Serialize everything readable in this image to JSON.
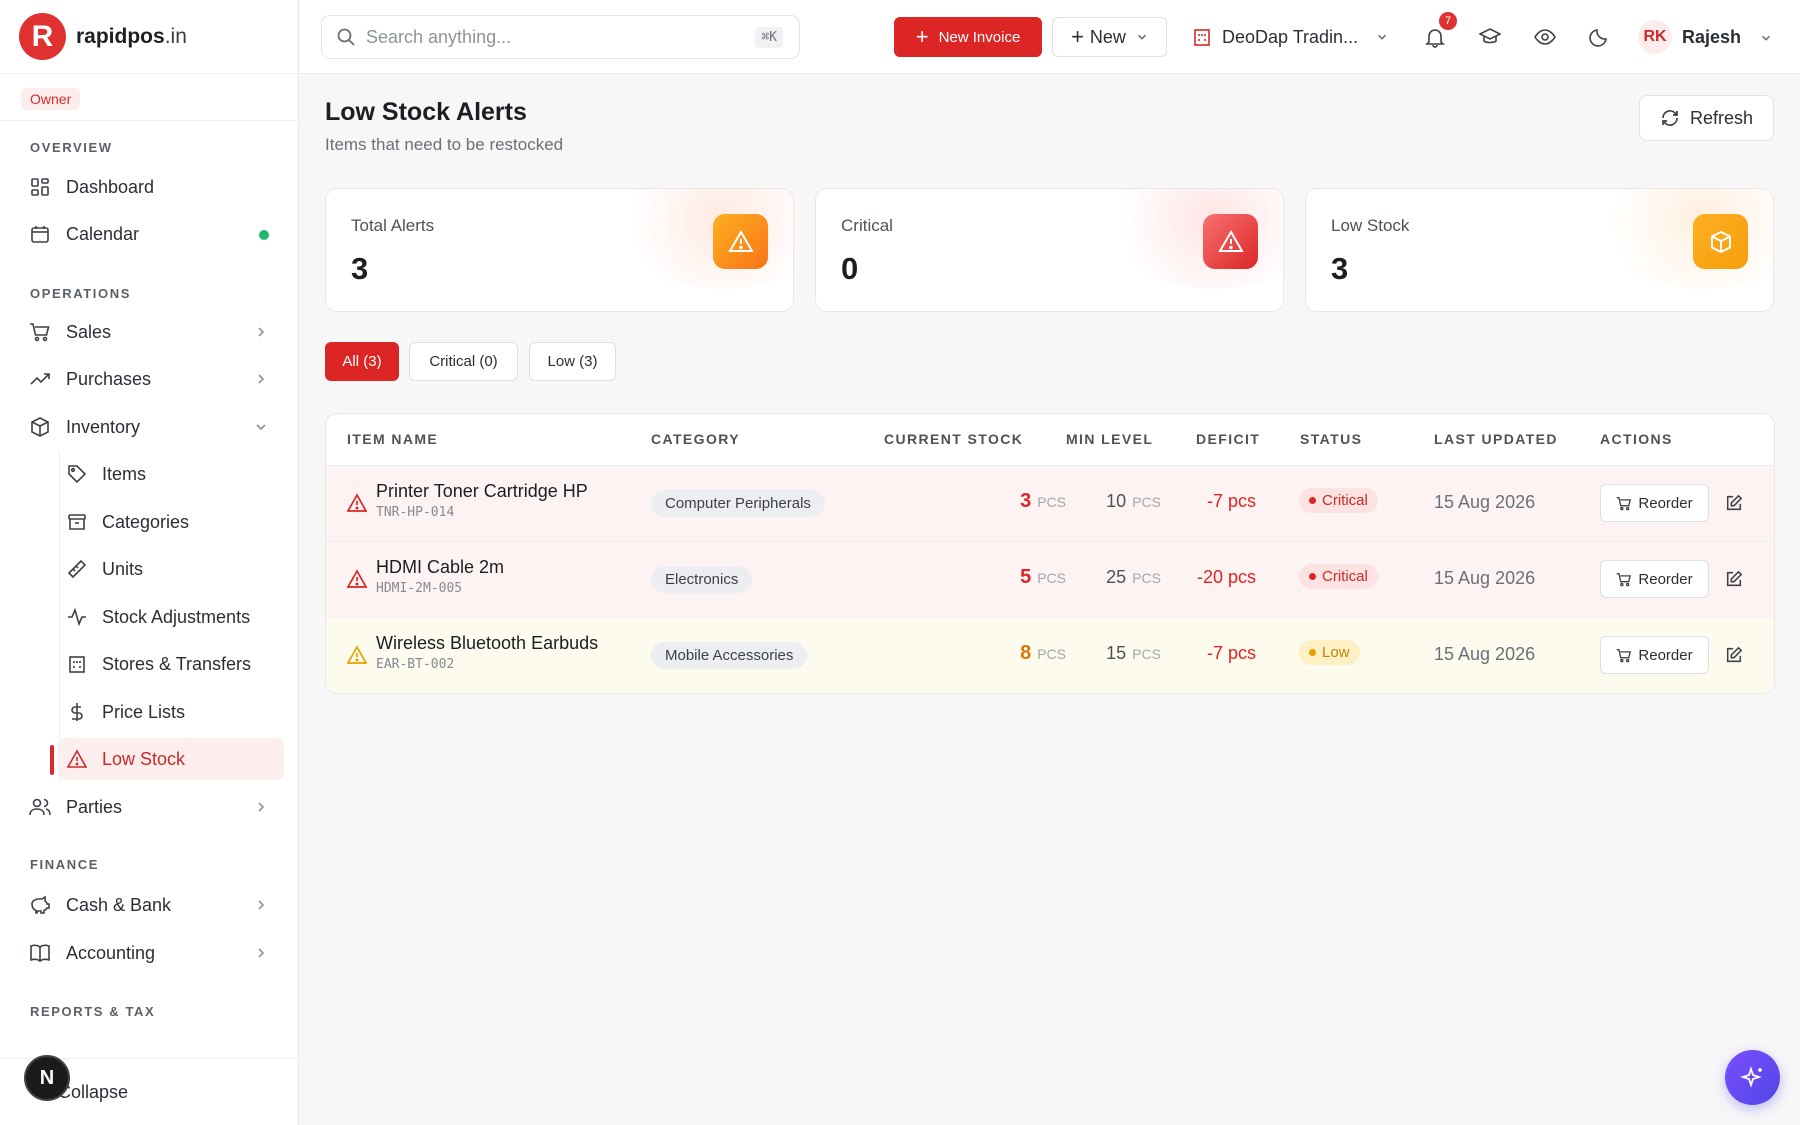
{
  "brand": {
    "initial": "R",
    "name": "rapidpos",
    "tld": ".in"
  },
  "role_badge": "Owner",
  "sidebar": {
    "sections": {
      "overview": "OVERVIEW",
      "operations": "OPERATIONS",
      "finance": "FINANCE",
      "reports": "REPORTS & TAX"
    },
    "items": {
      "dashboard": "Dashboard",
      "calendar": "Calendar",
      "sales": "Sales",
      "purchases": "Purchases",
      "inventory": "Inventory",
      "parties": "Parties",
      "cash_bank": "Cash & Bank",
      "accounting": "Accounting"
    },
    "inventory_sub": {
      "items": "Items",
      "categories": "Categories",
      "units": "Units",
      "stock_adjustments": "Stock Adjustments",
      "stores_transfers": "Stores & Transfers",
      "price_lists": "Price Lists",
      "low_stock": "Low Stock"
    },
    "collapse_label": "Collapse",
    "n_badge": "N"
  },
  "topbar": {
    "search_placeholder": "Search anything...",
    "search_shortcut": "⌘K",
    "new_invoice_label": "New Invoice",
    "new_label": "New",
    "company_name": "DeoDap Tradin...",
    "notification_count": "7",
    "user_initials": "RK",
    "user_name": "Rajesh"
  },
  "page": {
    "title": "Low Stock Alerts",
    "subtitle": "Items that need to be restocked",
    "refresh_label": "Refresh"
  },
  "cards": {
    "total": {
      "label": "Total Alerts",
      "value": "3"
    },
    "critical": {
      "label": "Critical",
      "value": "0"
    },
    "low": {
      "label": "Low Stock",
      "value": "3"
    }
  },
  "tabs": {
    "all": "All (3)",
    "critical": "Critical (0)",
    "low": "Low (3)"
  },
  "table": {
    "headers": {
      "item_name": "ITEM NAME",
      "category": "CATEGORY",
      "current_stock": "CURRENT STOCK",
      "min_level": "MIN LEVEL",
      "deficit": "DEFICIT",
      "status": "STATUS",
      "last_updated": "LAST UPDATED",
      "actions": "ACTIONS"
    },
    "unit": "PCS",
    "reorder_label": "Reorder",
    "rows": [
      {
        "name": "Printer Toner Cartridge HP",
        "sku": "TNR-HP-014",
        "category": "Computer Peripherals",
        "stock": "3",
        "min": "10",
        "deficit": "-7 pcs",
        "status": "Critical",
        "updated": "15 Aug 2026"
      },
      {
        "name": "HDMI Cable 2m",
        "sku": "HDMI-2M-005",
        "category": "Electronics",
        "stock": "5",
        "min": "25",
        "deficit": "-20 pcs",
        "status": "Critical",
        "updated": "15 Aug 2026"
      },
      {
        "name": "Wireless Bluetooth Earbuds",
        "sku": "EAR-BT-002",
        "category": "Mobile Accessories",
        "stock": "8",
        "min": "15",
        "deficit": "-7 pcs",
        "status": "Low",
        "updated": "15 Aug 2026"
      }
    ]
  },
  "colors": {
    "accent": "#dc2626",
    "critical_text": "#dc2626",
    "low_text": "#d97706",
    "success_dot": "#22b86b"
  }
}
